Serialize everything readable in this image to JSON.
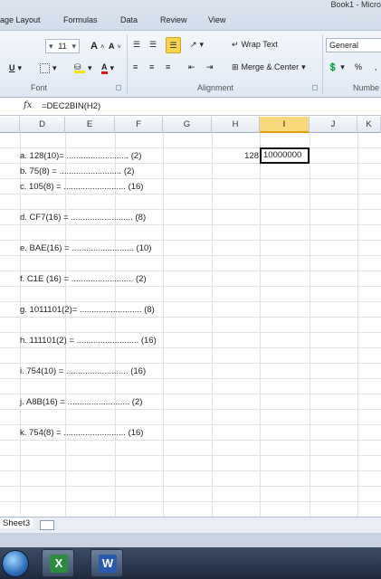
{
  "window": {
    "title": "Book1 - Micro"
  },
  "tabs": [
    "age Layout",
    "Formulas",
    "Data",
    "Review",
    "View"
  ],
  "ribbon": {
    "font_size": "11",
    "wrap_text": "Wrap Text",
    "merge_center": "Merge & Center",
    "number_format": "General",
    "percent": "%",
    "groups": {
      "font": "Font",
      "alignment": "Alignment",
      "number": "Numbe"
    }
  },
  "formula_bar": {
    "fx": "fx",
    "formula": "=DEC2BIN(H2)"
  },
  "columns": [
    "D",
    "E",
    "F",
    "G",
    "H",
    "I",
    "J",
    "K"
  ],
  "selected_column": "I",
  "cells": {
    "h2": "128",
    "i2": "10000000"
  },
  "exercises": [
    "a. 128(10)= .......................... (2)",
    "b. 75(8) = .......................... (2)",
    "c. 105(8) = .......................... (16)",
    "d. CF7(16) = .......................... (8)",
    "e. BAE(16) = .......................... (10)",
    "f. C1E (16) = .......................... (2)",
    "g. 1011101(2)= .......................... (8)",
    "h. 111101(2) = .......................... (16)",
    "i. 754(10) = .......................... (16)",
    "j. A8B(16) = .......................... (2)",
    "k. 754(8) = .......................... (16)"
  ],
  "sheet_tab": "Sheet3",
  "taskbar": {
    "excel": "X",
    "word": "W"
  },
  "colors": {
    "selection": "#f9d97a",
    "ribbon": "#dfe8f3",
    "taskbar": "#1f2b3c"
  }
}
